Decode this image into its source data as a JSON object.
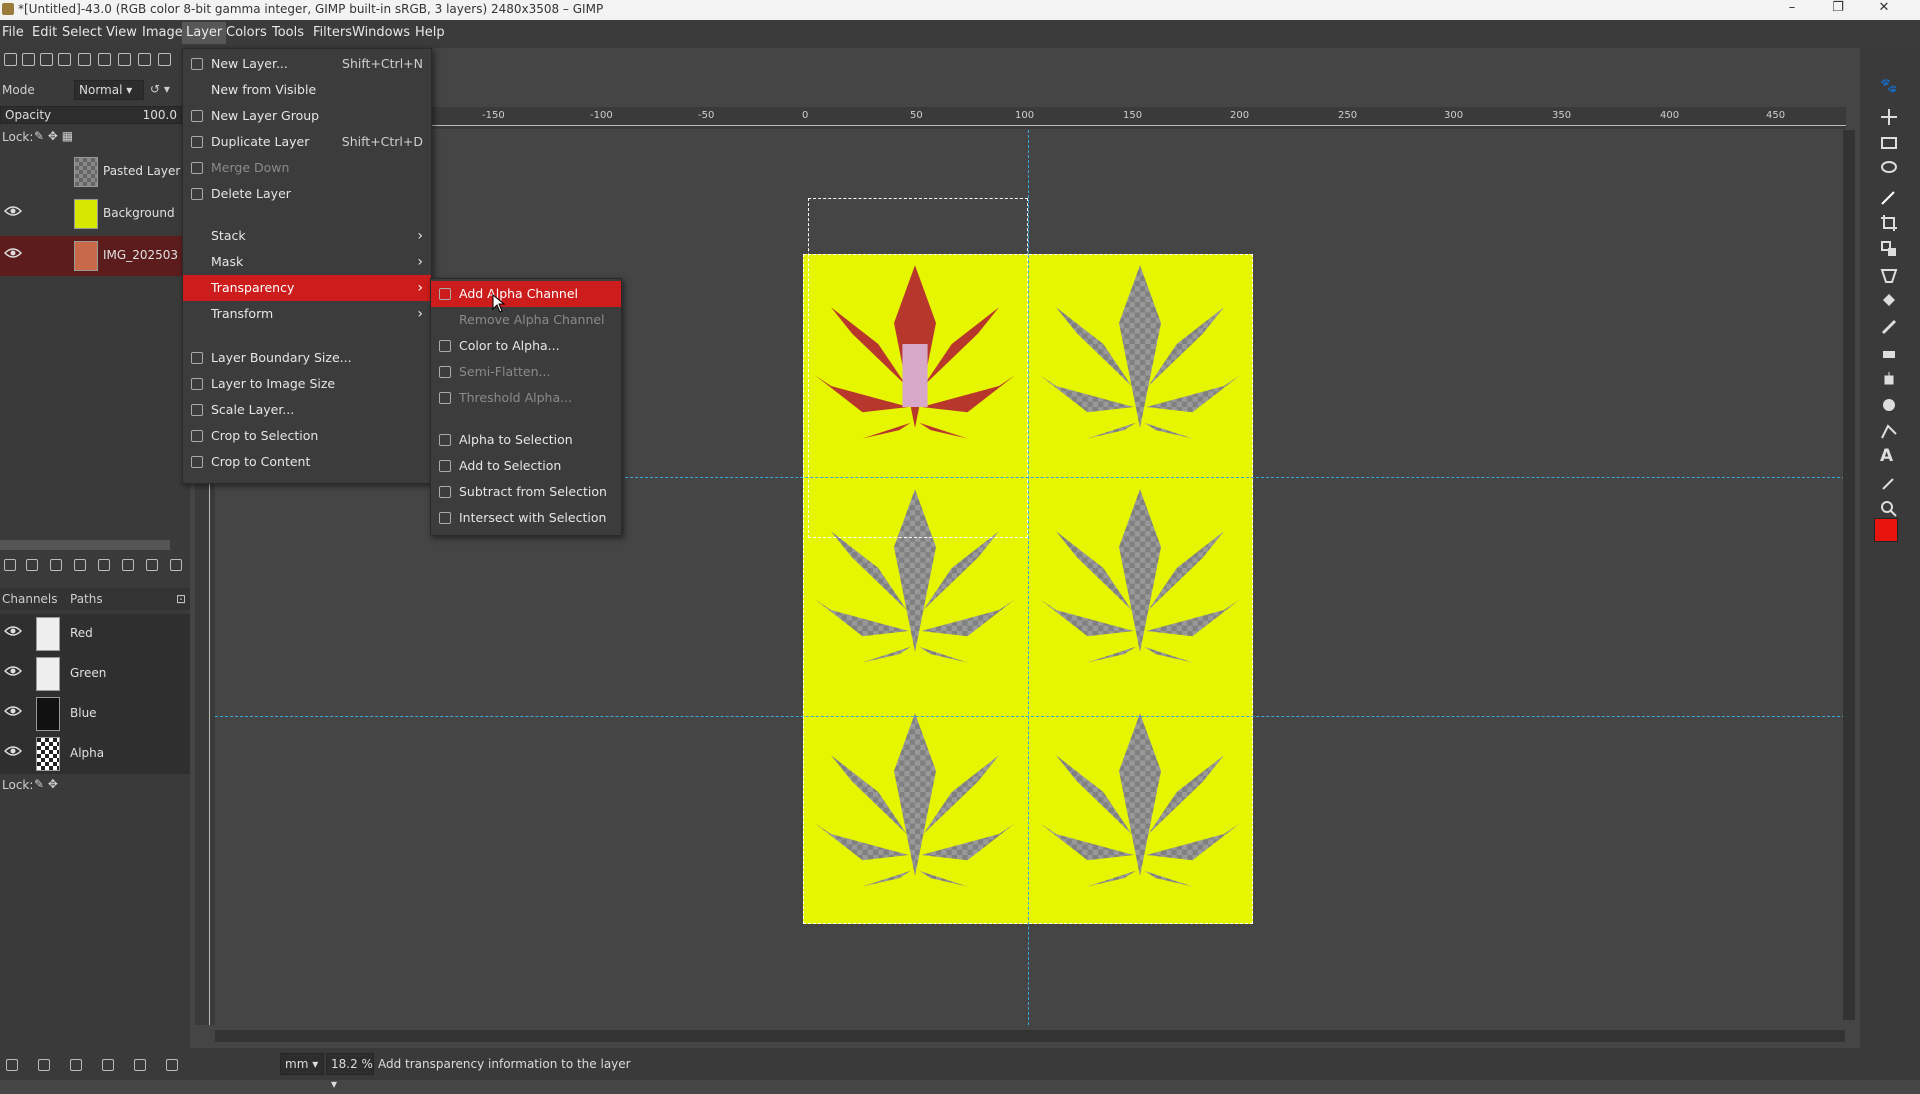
{
  "window": {
    "title": "*[Untitled]-43.0 (RGB color 8-bit gamma integer, GIMP built-in sRGB, 3 layers) 2480x3508 – GIMP",
    "minimize": "–",
    "maximize": "❐",
    "close": "✕"
  },
  "menubar": [
    "File",
    "Edit",
    "Select",
    "View",
    "Image",
    "Layer",
    "Colors",
    "Tools",
    "Filters",
    "Windows",
    "Help"
  ],
  "layers_panel": {
    "mode_label": "Mode",
    "mode_value": "Normal",
    "opacity_label": "Opacity",
    "opacity_value": "100.0",
    "lock_label": "Lock:",
    "layers": [
      {
        "name": "Pasted Layer",
        "visible": false,
        "selected": false
      },
      {
        "name": "Background",
        "visible": true,
        "selected": false
      },
      {
        "name": "IMG_202503",
        "visible": true,
        "selected": true
      }
    ]
  },
  "channels_panel": {
    "tabs": [
      "Channels",
      "Paths"
    ],
    "channels": [
      "Red",
      "Green",
      "Blue",
      "Alpha"
    ],
    "lock_label": "Lock:"
  },
  "layer_menu": {
    "items": [
      {
        "label": "New Layer...",
        "shortcut": "Shift+Ctrl+N",
        "disabled": false
      },
      {
        "label": "New from Visible",
        "shortcut": "",
        "disabled": false
      },
      {
        "label": "New Layer Group",
        "shortcut": "",
        "disabled": false
      },
      {
        "label": "Duplicate Layer",
        "shortcut": "Shift+Ctrl+D",
        "disabled": false
      },
      {
        "label": "Merge Down",
        "shortcut": "",
        "disabled": true
      },
      {
        "label": "Delete Layer",
        "shortcut": "",
        "disabled": false
      },
      {
        "label": "Stack",
        "submenu": true
      },
      {
        "label": "Mask",
        "submenu": true
      },
      {
        "label": "Transparency",
        "submenu": true,
        "highlighted": true
      },
      {
        "label": "Transform",
        "submenu": true
      },
      {
        "label": "Layer Boundary Size...",
        "shortcut": "",
        "disabled": false
      },
      {
        "label": "Layer to Image Size",
        "shortcut": "",
        "disabled": false
      },
      {
        "label": "Scale Layer...",
        "shortcut": "",
        "disabled": false
      },
      {
        "label": "Crop to Selection",
        "shortcut": "",
        "disabled": false
      },
      {
        "label": "Crop to Content",
        "shortcut": "",
        "disabled": false
      }
    ]
  },
  "transparency_menu": {
    "items": [
      {
        "label": "Add Alpha Channel",
        "disabled": false,
        "highlighted": true
      },
      {
        "label": "Remove Alpha Channel",
        "disabled": true
      },
      {
        "label": "Color to Alpha...",
        "disabled": false
      },
      {
        "label": "Semi-Flatten...",
        "disabled": true
      },
      {
        "label": "Threshold Alpha...",
        "disabled": true
      },
      {
        "label": "Alpha to Selection",
        "disabled": false
      },
      {
        "label": "Add to Selection",
        "disabled": false
      },
      {
        "label": "Subtract from Selection",
        "disabled": false
      },
      {
        "label": "Intersect with Selection",
        "disabled": false
      }
    ]
  },
  "ruler": {
    "top_ticks": [
      "-150",
      "-100",
      "-50",
      "0",
      "50",
      "100",
      "150",
      "200",
      "250",
      "300",
      "350",
      "400",
      "450"
    ]
  },
  "statusbar": {
    "unit": "mm",
    "zoom": "18.2 %",
    "message": "Add transparency information to the layer"
  },
  "colors": {
    "foreground": "#e8150e",
    "background": "#e8f000",
    "canvas_yellow": "#e6f500",
    "highlight": "#cc1c1c"
  }
}
